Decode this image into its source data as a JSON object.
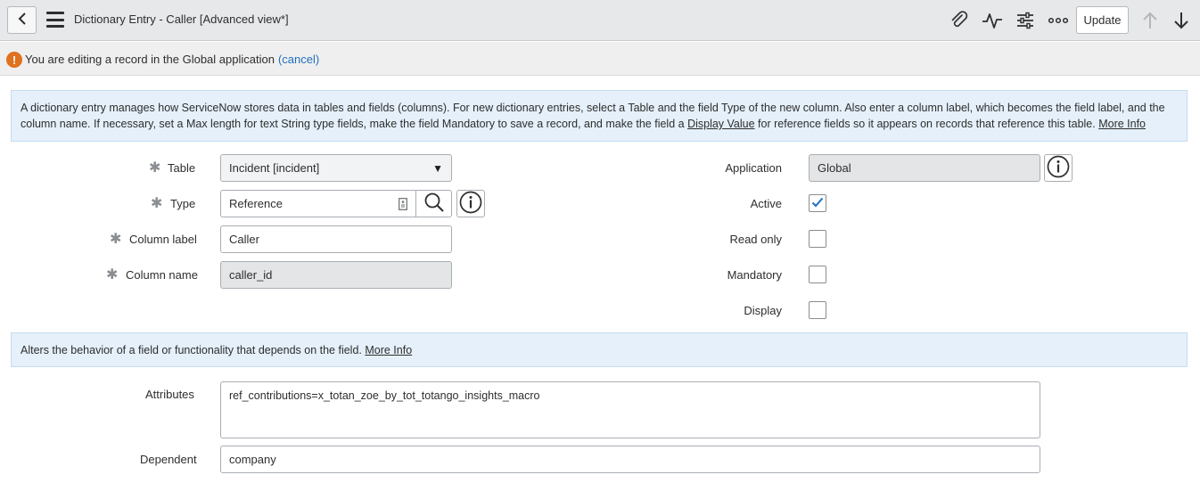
{
  "header": {
    "title": "Dictionary Entry - Caller [Advanced view*]",
    "update_label": "Update"
  },
  "notice": {
    "text": "You are editing a record in the Global application",
    "cancel_label": "(cancel)"
  },
  "info1": {
    "part1": "A dictionary entry manages how ServiceNow stores data in tables and fields (columns). For new dictionary entries, select a Table and the field Type of the new column. Also enter a column label, which becomes the field label, and the column name. If necessary, set a Max length for text String type fields, make the field Mandatory to save a record, and make the field a ",
    "display_value_link": "Display Value",
    "part2": " for reference fields so it appears on records that reference this table. ",
    "more_info": "More Info"
  },
  "info2": {
    "text": "Alters the behavior of a field or functionality that depends on the field. ",
    "more_info": "More Info"
  },
  "form": {
    "table_label": "Table",
    "table_value": "Incident [incident]",
    "type_label": "Type",
    "type_value": "Reference",
    "column_label_label": "Column label",
    "column_label_value": "Caller",
    "column_name_label": "Column name",
    "column_name_value": "caller_id",
    "application_label": "Application",
    "application_value": "Global",
    "active_label": "Active",
    "active_checked": true,
    "read_only_label": "Read only",
    "read_only_checked": false,
    "mandatory_label": "Mandatory",
    "mandatory_checked": false,
    "display_label": "Display",
    "display_checked": false,
    "attributes_label": "Attributes",
    "attributes_value": "ref_contributions=x_totan_zoe_by_tot_totango_insights_macro",
    "dependent_label": "Dependent",
    "dependent_value": "company"
  },
  "colors": {
    "header_bg": "#e6e8ea",
    "info_bg": "#e5f0fa",
    "warning": "#e0711f",
    "link": "#1f6fbf",
    "check": "#1f6fbf"
  }
}
